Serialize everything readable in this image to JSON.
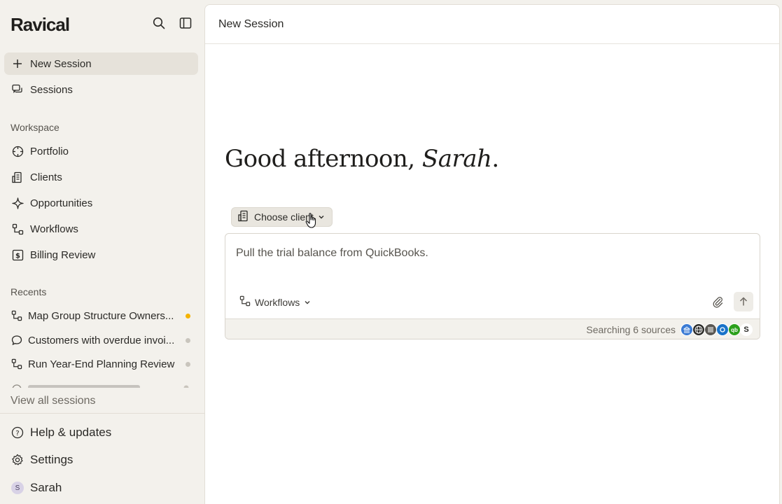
{
  "app": {
    "name": "Ravical"
  },
  "sidebar": {
    "new_session": "New Session",
    "sessions": "Sessions",
    "workspace_label": "Workspace",
    "workspace_items": [
      {
        "label": "Portfolio",
        "icon": "crosshair-icon"
      },
      {
        "label": "Clients",
        "icon": "building-icon"
      },
      {
        "label": "Opportunities",
        "icon": "sparkle-icon"
      },
      {
        "label": "Workflows",
        "icon": "workflow-icon"
      },
      {
        "label": "Billing Review",
        "icon": "dollar-icon"
      }
    ],
    "recents_label": "Recents",
    "recents": [
      {
        "label": "Map Group Structure Owners...",
        "icon": "workflow-icon",
        "dot_color": "#f5b301"
      },
      {
        "label": "Customers with overdue invoi...",
        "icon": "chat-icon",
        "dot_color": "#c9c5bd"
      },
      {
        "label": "Run Year-End Planning Review",
        "icon": "workflow-icon",
        "dot_color": "#c9c5bd"
      }
    ],
    "view_all": "View all sessions",
    "help": "Help & updates",
    "settings": "Settings",
    "user": {
      "name": "Sarah",
      "initial": "S"
    }
  },
  "main": {
    "title": "New Session",
    "greeting_prefix": "Good afternoon, ",
    "greeting_name": "Sarah",
    "greeting_suffix": ".",
    "client_chip": "Choose client",
    "prompt_text": "Pull the trial balance from QuickBooks.",
    "workflows_label": "Workflows",
    "sources_text": "Searching 6 sources",
    "sources": [
      {
        "name": "bank-icon",
        "color": "#3b7bd4"
      },
      {
        "name": "globe-icon",
        "color": "#2b2a27"
      },
      {
        "name": "kpmg-icon",
        "color": "#5a5752"
      },
      {
        "name": "outlook-icon",
        "color": "#1a73c9"
      },
      {
        "name": "quickbooks-icon",
        "color": "#2ca01c",
        "label": "qb"
      },
      {
        "name": "stripe-icon",
        "color": "#2b2a27",
        "label": "S"
      }
    ]
  },
  "colors": {
    "accent_dot": "#f5b301",
    "sidebar_bg": "#f3f1ec"
  }
}
